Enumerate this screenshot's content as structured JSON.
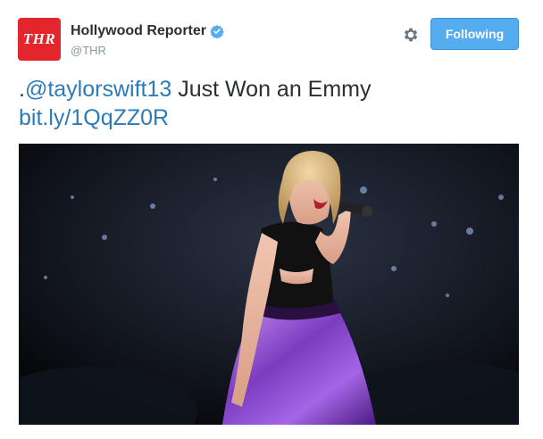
{
  "account": {
    "avatar_text": "THR",
    "name": "Hollywood Reporter",
    "handle": "@THR",
    "verified": true
  },
  "actions": {
    "settings_icon": "gear-icon",
    "follow_label": "Following"
  },
  "tweet": {
    "prefix": ".",
    "mention": "@taylorswift13",
    "text": " Just Won an Emmy",
    "link": "bit.ly/1QqZZ0R"
  },
  "media": {
    "icon": "photo",
    "description": "concert-performer-photo"
  },
  "colors": {
    "brand_red": "#e2262b",
    "link_blue": "#2b7bb9",
    "button_blue": "#55acee",
    "text": "#292f33",
    "muted": "#8899a6"
  }
}
